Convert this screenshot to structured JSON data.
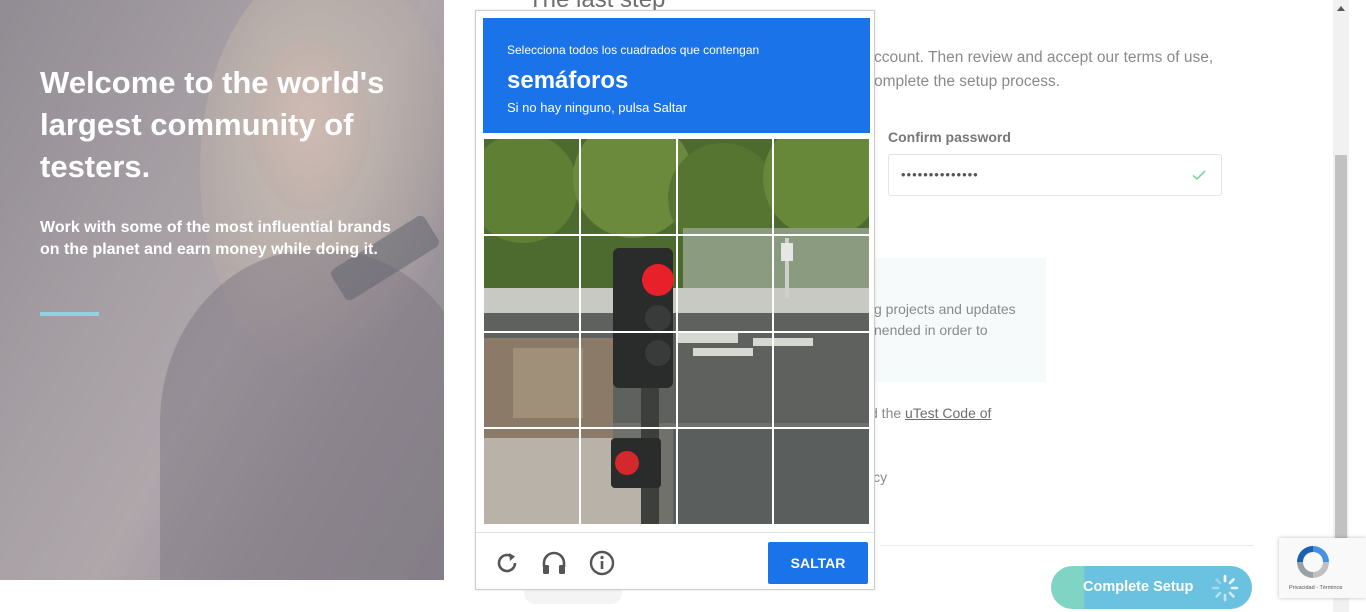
{
  "hero": {
    "title": "Welcome to the world's largest community of testers.",
    "subtitle": "Work with some of the most influential brands on the planet and earn money while doing it."
  },
  "form": {
    "heading": "The last step",
    "intro": "ccount. Then review and accept our terms of use, omplete the setup process.",
    "confirm_password_label": "Confirm password",
    "confirm_password_value": "••••••••••••••",
    "info_text": "g projects and updates nended in order to",
    "terms_prefix": "d the ",
    "terms_link": "uTest Code of",
    "policy_fragment": "icy",
    "complete_button": "Complete Setup"
  },
  "recaptcha_badge": {
    "links": "Privacidad - Términos"
  },
  "captcha": {
    "instruction": "Selecciona todos los cuadrados que contengan",
    "target": "semáforos",
    "hint": "Si no hay ninguno, pulsa Saltar",
    "skip_button": "SALTAR",
    "tile_count": 16,
    "controls": [
      "reload-icon",
      "audio-headphones-icon",
      "info-icon"
    ]
  },
  "colors": {
    "captcha_blue": "#1a73e8",
    "button_teal": "#7fd4c3",
    "button_blue": "#6bc2e0",
    "hero_accent": "#8fd3e3"
  }
}
